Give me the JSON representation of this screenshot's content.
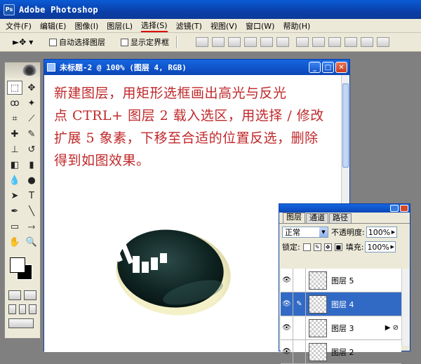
{
  "app": {
    "title": "Adobe Photoshop",
    "icon_text": "Ps"
  },
  "menu": [
    "文件(F)",
    "编辑(E)",
    "图像(I)",
    "图层(L)",
    "选择(S)",
    "滤镜(T)",
    "视图(V)",
    "窗口(W)",
    "帮助(H)"
  ],
  "menu_active_index": 4,
  "options": {
    "tool_glyph": "►✥",
    "auto_select": "自动选择图层",
    "show_bounds": "显示定界框"
  },
  "document": {
    "title": "未标题-2 @ 100% (图层 4, RGB)",
    "instructions": [
      "新建图层，用矩形选框画出高光与反光",
      "点 CTRL+ 图层 2 载入选区，用选择 / 修改",
      "扩展 5 象素，下移至合适的位置反选，删除",
      "得到如图效果。"
    ],
    "text_color": "#c0282a"
  },
  "window_buttons": {
    "minimize": "_",
    "maximize": "□",
    "close": "✕"
  },
  "layers_panel": {
    "tabs": [
      "图层",
      "通道",
      "路径"
    ],
    "blend_mode": "正常",
    "opacity_label": "不透明度:",
    "opacity_value": "100%",
    "lock_label": "锁定:",
    "fill_label": "填充:",
    "fill_value": "100%",
    "layers": [
      {
        "name": "图层 5",
        "selected": false
      },
      {
        "name": "图层 4",
        "selected": true
      },
      {
        "name": "图层 3",
        "selected": false,
        "effects": true
      },
      {
        "name": "图层 2",
        "selected": false
      }
    ]
  }
}
